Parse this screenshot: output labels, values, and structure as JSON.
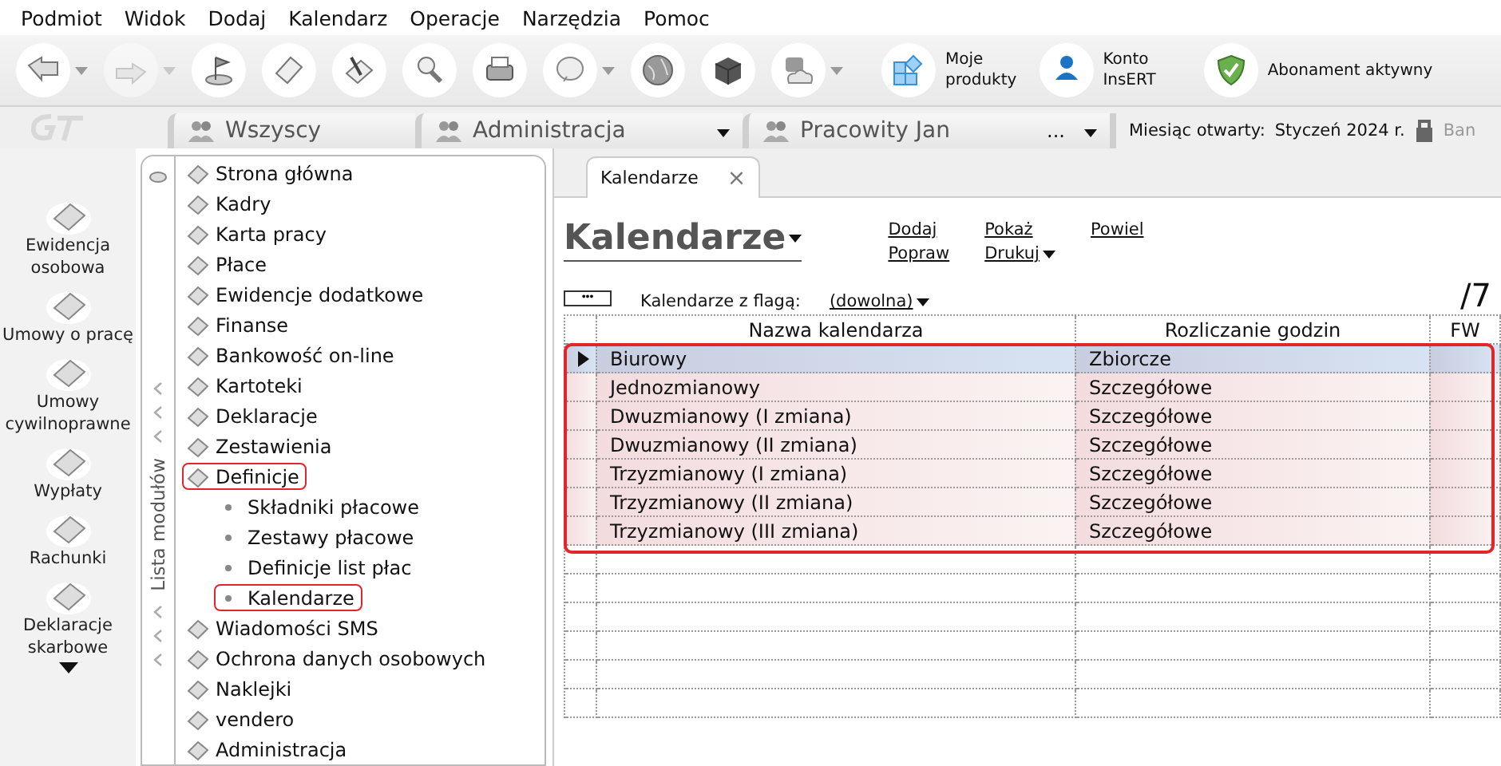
{
  "menu": [
    "Podmiot",
    "Widok",
    "Dodaj",
    "Kalendarz",
    "Operacje",
    "Narzędzia",
    "Pomoc"
  ],
  "toolbar": {
    "buttons": [
      {
        "kind": "arrow-left",
        "dropdown": true,
        "disabled": false
      },
      {
        "kind": "arrow-right",
        "dropdown": true,
        "disabled": true
      },
      {
        "kind": "flag",
        "dropdown": false,
        "disabled": false
      },
      {
        "kind": "sheet",
        "dropdown": false,
        "disabled": false
      },
      {
        "kind": "pen",
        "dropdown": false,
        "disabled": false
      },
      {
        "kind": "magnifier",
        "dropdown": false,
        "disabled": false
      },
      {
        "kind": "printer",
        "dropdown": false,
        "disabled": false
      },
      {
        "kind": "help",
        "dropdown": true,
        "disabled": false
      },
      {
        "kind": "globe",
        "dropdown": false,
        "disabled": false
      },
      {
        "kind": "cube",
        "dropdown": false,
        "disabled": false
      },
      {
        "kind": "cloud",
        "dropdown": true,
        "disabled": false
      }
    ],
    "labeled": [
      {
        "kind": "tiles",
        "lines": [
          "Moje",
          "produkty"
        ]
      },
      {
        "kind": "account",
        "lines": [
          "Konto",
          "InsERT"
        ]
      },
      {
        "kind": "shield",
        "lines": [
          "Abonament aktywny"
        ]
      }
    ]
  },
  "context": {
    "tabs": [
      {
        "label": "Wszyscy",
        "dropdown": false
      },
      {
        "label": "Administracja",
        "dropdown": true
      },
      {
        "label": "Pracowity Jan",
        "dropdown": true,
        "extra": "..."
      }
    ],
    "month_label": "Miesiąc otwarty:",
    "month_value": "Styczeń 2024 r.",
    "cut_label": "Ban"
  },
  "rail": {
    "items": [
      "Ewidencja osobowa",
      "Umowy o pracę",
      "Umowy cywilnoprawne",
      "Wypłaty",
      "Rachunki",
      "Deklaracje skarbowe"
    ]
  },
  "modules": {
    "title": "Lista modułów",
    "items": [
      {
        "label": "Strona główna",
        "highlighted": false
      },
      {
        "label": "Kadry",
        "highlighted": false
      },
      {
        "label": "Karta pracy",
        "highlighted": false
      },
      {
        "label": "Płace",
        "highlighted": false
      },
      {
        "label": "Ewidencje dodatkowe",
        "highlighted": false
      },
      {
        "label": "Finanse",
        "highlighted": false
      },
      {
        "label": "Bankowość on-line",
        "highlighted": false
      },
      {
        "label": "Kartoteki",
        "highlighted": false
      },
      {
        "label": "Deklaracje",
        "highlighted": false
      },
      {
        "label": "Zestawienia",
        "highlighted": false
      },
      {
        "label": "Definicje",
        "highlighted": true,
        "children": [
          {
            "label": "Składniki płacowe",
            "highlighted": false
          },
          {
            "label": "Zestawy płacowe",
            "highlighted": false
          },
          {
            "label": "Definicje list płac",
            "highlighted": false
          },
          {
            "label": "Kalendarze",
            "highlighted": true
          }
        ]
      },
      {
        "label": "Wiadomości SMS",
        "highlighted": false
      },
      {
        "label": "Ochrona danych osobowych",
        "highlighted": false
      },
      {
        "label": "Naklejki",
        "highlighted": false
      },
      {
        "label": "vendero",
        "highlighted": false
      },
      {
        "label": "Administracja",
        "highlighted": false
      }
    ]
  },
  "document_tab": {
    "label": "Kalendarze",
    "close": "×"
  },
  "header": {
    "title": "Kalendarze",
    "actions": [
      [
        {
          "label": "Dodaj",
          "dropdown": false
        },
        {
          "label": "Popraw",
          "dropdown": false
        }
      ],
      [
        {
          "label": "Pokaż",
          "dropdown": false
        },
        {
          "label": "Drukuj",
          "dropdown": true
        }
      ],
      [
        {
          "label": "Powiel",
          "dropdown": false
        }
      ]
    ]
  },
  "filter": {
    "more": "•••",
    "label": "Kalendarze z flagą:",
    "value": "(dowolna)",
    "count": "/7"
  },
  "table": {
    "columns": [
      "Nazwa kalendarza",
      "Rozliczanie godzin",
      "FW"
    ],
    "highlighted": true,
    "rows": [
      {
        "name": "Biurowy",
        "mode": "Zbiorcze",
        "selected": true
      },
      {
        "name": "Jednozmianowy",
        "mode": "Szczegółowe",
        "selected": false
      },
      {
        "name": "Dwuzmianowy (I zmiana)",
        "mode": "Szczegółowe",
        "selected": false
      },
      {
        "name": "Dwuzmianowy (II zmiana)",
        "mode": "Szczegółowe",
        "selected": false
      },
      {
        "name": "Trzyzmianowy (I zmiana)",
        "mode": "Szczegółowe",
        "selected": false
      },
      {
        "name": "Trzyzmianowy (II zmiana)",
        "mode": "Szczegółowe",
        "selected": false
      },
      {
        "name": "Trzyzmianowy (III zmiana)",
        "mode": "Szczegółowe",
        "selected": false
      }
    ]
  }
}
